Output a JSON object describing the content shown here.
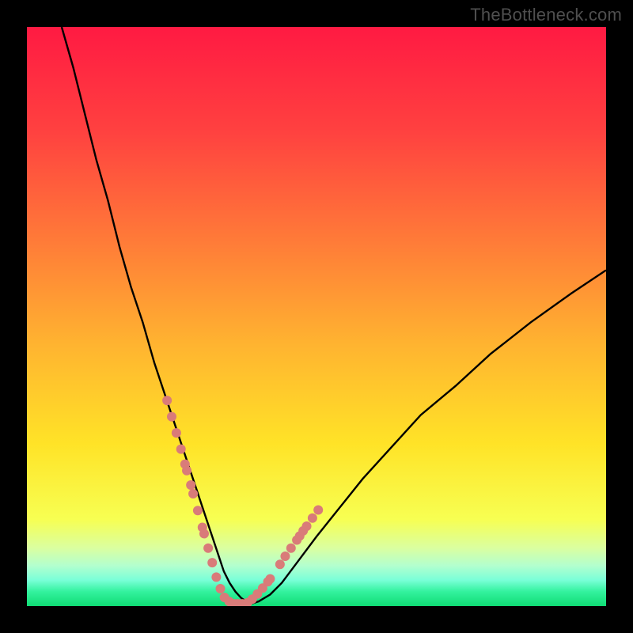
{
  "watermark": "TheBottleneck.com",
  "chart_data": {
    "type": "line",
    "title": "",
    "xlabel": "",
    "ylabel": "",
    "xlim": [
      0,
      100
    ],
    "ylim": [
      0,
      100
    ],
    "grid": false,
    "legend": false,
    "gradient_stops": [
      {
        "offset": 0.0,
        "color": "#ff1a42"
      },
      {
        "offset": 0.18,
        "color": "#ff4140"
      },
      {
        "offset": 0.37,
        "color": "#ff7b38"
      },
      {
        "offset": 0.55,
        "color": "#ffb430"
      },
      {
        "offset": 0.72,
        "color": "#ffe327"
      },
      {
        "offset": 0.85,
        "color": "#f7ff52"
      },
      {
        "offset": 0.9,
        "color": "#daffa1"
      },
      {
        "offset": 0.93,
        "color": "#b3ffce"
      },
      {
        "offset": 0.955,
        "color": "#7affd8"
      },
      {
        "offset": 0.975,
        "color": "#33f29e"
      },
      {
        "offset": 1.0,
        "color": "#0fdc74"
      }
    ],
    "series": [
      {
        "name": "bottleneck-curve",
        "stroke": "#000000",
        "x": [
          6,
          8,
          10,
          12,
          14,
          16,
          18,
          20,
          22,
          24,
          26,
          27,
          28,
          29,
          30,
          31,
          32,
          33,
          34,
          35,
          36,
          37,
          38,
          39,
          40,
          42,
          44,
          47,
          50,
          54,
          58,
          63,
          68,
          74,
          80,
          87,
          94,
          100
        ],
        "y": [
          100,
          93,
          85,
          77,
          70,
          62,
          55,
          49,
          42,
          36,
          30,
          27,
          24,
          21,
          18,
          15,
          12,
          9,
          6,
          4,
          2.5,
          1.4,
          0.7,
          0.5,
          0.8,
          2,
          4,
          8,
          12,
          17,
          22,
          27.5,
          33,
          38,
          43.5,
          49,
          54,
          58
        ]
      }
    ],
    "marker_series": [
      {
        "name": "curve-markers",
        "color": "#d97b79",
        "radius_px": 6,
        "x": [
          24.2,
          25.0,
          25.8,
          26.6,
          27.3,
          27.6,
          28.3,
          28.7,
          29.5,
          30.3,
          30.6,
          31.3,
          32.0,
          32.7,
          33.4,
          34.1,
          34.9,
          35.8,
          36.4,
          37.2,
          38.1,
          38.9,
          39.8,
          40.7,
          41.6,
          42.0,
          43.7,
          44.6,
          45.6,
          46.6,
          47.1,
          47.7,
          48.3,
          49.3,
          50.3
        ],
        "y": [
          35.5,
          32.7,
          29.9,
          27.1,
          24.5,
          23.4,
          20.9,
          19.4,
          16.5,
          13.6,
          12.5,
          10.0,
          7.5,
          5.0,
          3.0,
          1.5,
          0.8,
          0.4,
          0.4,
          0.4,
          0.6,
          1.2,
          2.1,
          3.1,
          4.2,
          4.7,
          7.2,
          8.6,
          10.0,
          11.4,
          12.1,
          13.0,
          13.8,
          15.2,
          16.6
        ]
      }
    ]
  }
}
